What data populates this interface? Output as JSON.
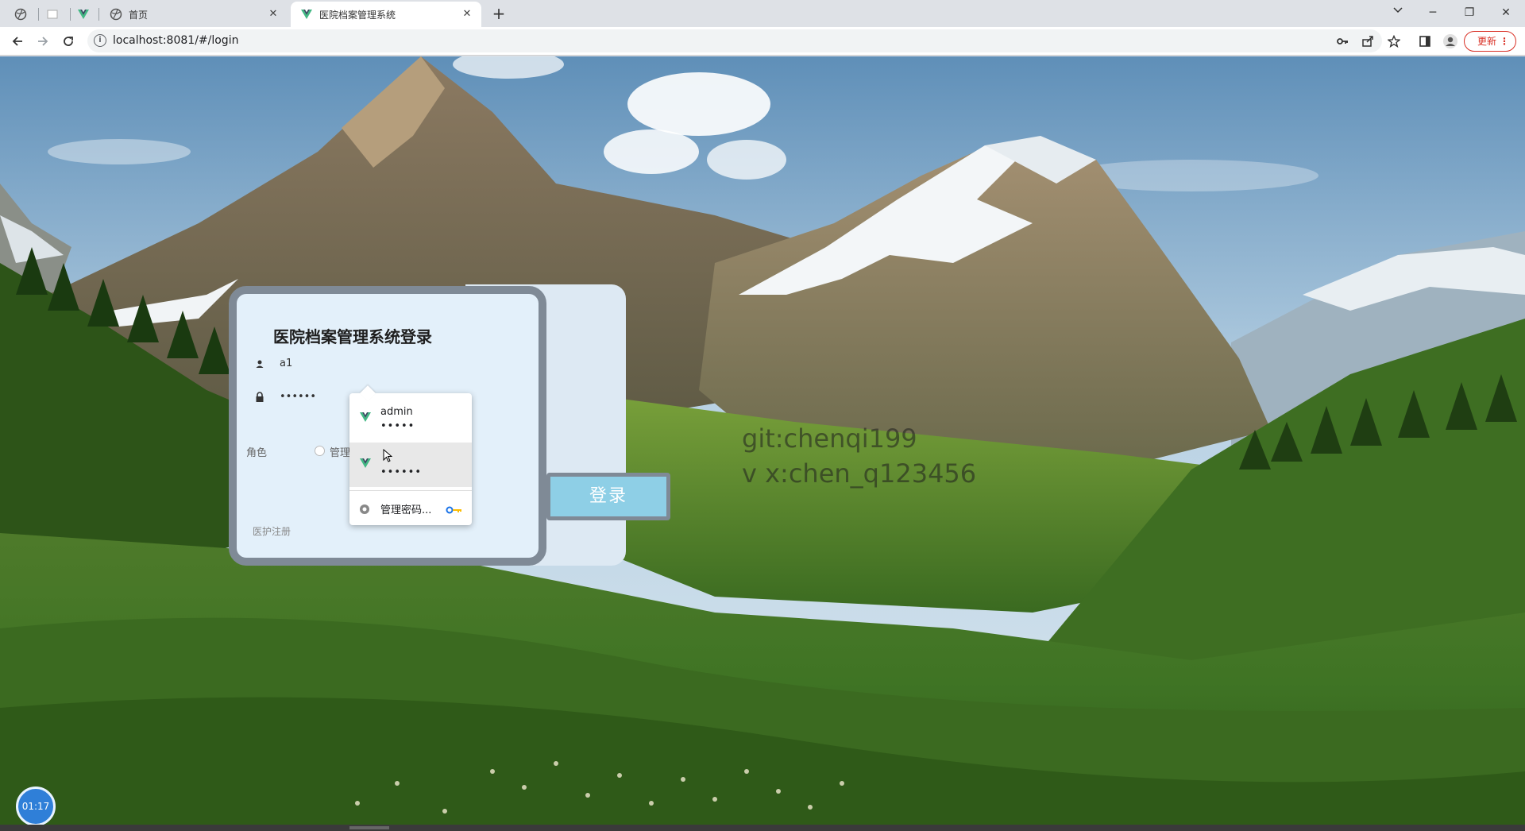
{
  "browser": {
    "tabs": [
      {
        "label": "首页",
        "active": false
      },
      {
        "label": "医院档案管理系统",
        "active": true
      }
    ],
    "url": "localhost:8081/#/login",
    "update_label": "更新"
  },
  "login": {
    "title": "医院档案管理系统登录",
    "username_value": "a1",
    "password_value": "••••••",
    "role_label": "角色",
    "role_option_partial": "管理",
    "register_link": "医护注册",
    "login_button": "登录"
  },
  "autofill": {
    "entries": [
      {
        "username": "admin",
        "password": "•••••"
      },
      {
        "username": "",
        "password": "••••••"
      }
    ],
    "manage_label": "管理密码..."
  },
  "overlay": {
    "watermark_line1": "git:chenqi199",
    "watermark_line2": "v x:chen_q123456",
    "timer": "01:17"
  },
  "colors": {
    "card_border": "#7f8a96",
    "card_bg": "#e3f0fa",
    "button_bg": "#8ecfe6",
    "vue_green": "#41b883",
    "vue_dark": "#35495e"
  }
}
